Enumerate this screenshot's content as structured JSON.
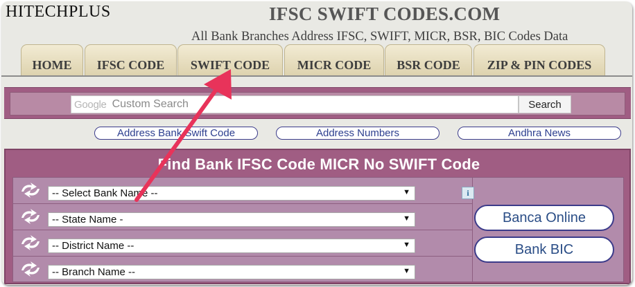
{
  "header": {
    "logo": "HITECHPLUS",
    "site_title": "IFSC SWIFT CODES.COM",
    "tagline": "All Bank Branches Address IFSC, SWIFT, MICR, BSR, BIC Codes Data"
  },
  "tabs": [
    {
      "label": "HOME"
    },
    {
      "label": "IFSC CODE"
    },
    {
      "label": "SWIFT CODE"
    },
    {
      "label": "MICR CODE"
    },
    {
      "label": "BSR CODE"
    },
    {
      "label": "ZIP & PIN CODES"
    }
  ],
  "search": {
    "google_logo": "Google",
    "placeholder": "Custom Search",
    "button_label": "Search"
  },
  "links": [
    {
      "label": "Address Bank Swift Code"
    },
    {
      "label": "Address Numbers"
    },
    {
      "label": "Andhra News"
    }
  ],
  "finder": {
    "title": "Find Bank IFSC Code MICR No SWIFT Code",
    "selects": [
      {
        "value": "-- Select Bank Name --"
      },
      {
        "value": "-- State Name -"
      },
      {
        "value": "-- District Name --"
      },
      {
        "value": "-- Branch Name --"
      }
    ],
    "info_glyph": "i",
    "side_buttons": [
      {
        "label": "Banca Online"
      },
      {
        "label": "Bank BIC"
      }
    ]
  },
  "colors": {
    "accent_purple": "#a05d83",
    "panel_purple": "#b28bab",
    "tab_beige": "#e8dfc0",
    "annotation_arrow": "#e8335a"
  },
  "icons": {
    "selector_rows": "refresh-arrows-icon",
    "info": "info-icon"
  }
}
